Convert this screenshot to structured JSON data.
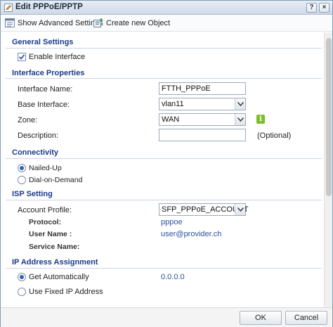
{
  "dialog": {
    "title": "Edit PPPoE/PPTP",
    "help_glyph": "?",
    "close_glyph": "×"
  },
  "toolbar": {
    "show_advanced": "Show Advanced Settings",
    "create_object": "Create new Object"
  },
  "general": {
    "title": "General Settings",
    "enable_interface_label": "Enable Interface",
    "enable_interface_checked": true
  },
  "interface_properties": {
    "title": "Interface Properties",
    "name_label": "Interface Name:",
    "name_value": "FTTH_PPPoE",
    "base_label": "Base Interface:",
    "base_value": "vlan11",
    "zone_label": "Zone:",
    "zone_value": "WAN",
    "description_label": "Description:",
    "description_value": "",
    "optional_text": "(Optional)"
  },
  "connectivity": {
    "title": "Connectivity",
    "nailed_up": "Nailed-Up",
    "dial_on_demand": "Dial-on-Demand",
    "selected": "Nailed-Up"
  },
  "isp": {
    "title": "ISP Setting",
    "account_profile_label": "Account Profile:",
    "account_profile_value": "SFP_PPPoE_ACCOUNT",
    "protocol_label": "Protocol:",
    "protocol_value": "pppoe",
    "username_label": "User Name :",
    "username_value": "user@provider.ch",
    "service_label": "Service Name:",
    "service_value": ""
  },
  "ip": {
    "title": "IP Address Assignment",
    "get_auto": "Get Automatically",
    "get_auto_value": "0.0.0.0",
    "fixed": "Use Fixed IP Address",
    "selected": "Get Automatically"
  },
  "footer": {
    "ok": "OK",
    "cancel": "Cancel"
  },
  "colors": {
    "section_title": "#1a3b8a",
    "link_value": "#2a4f9a",
    "info_icon": "#7bbf2a"
  }
}
